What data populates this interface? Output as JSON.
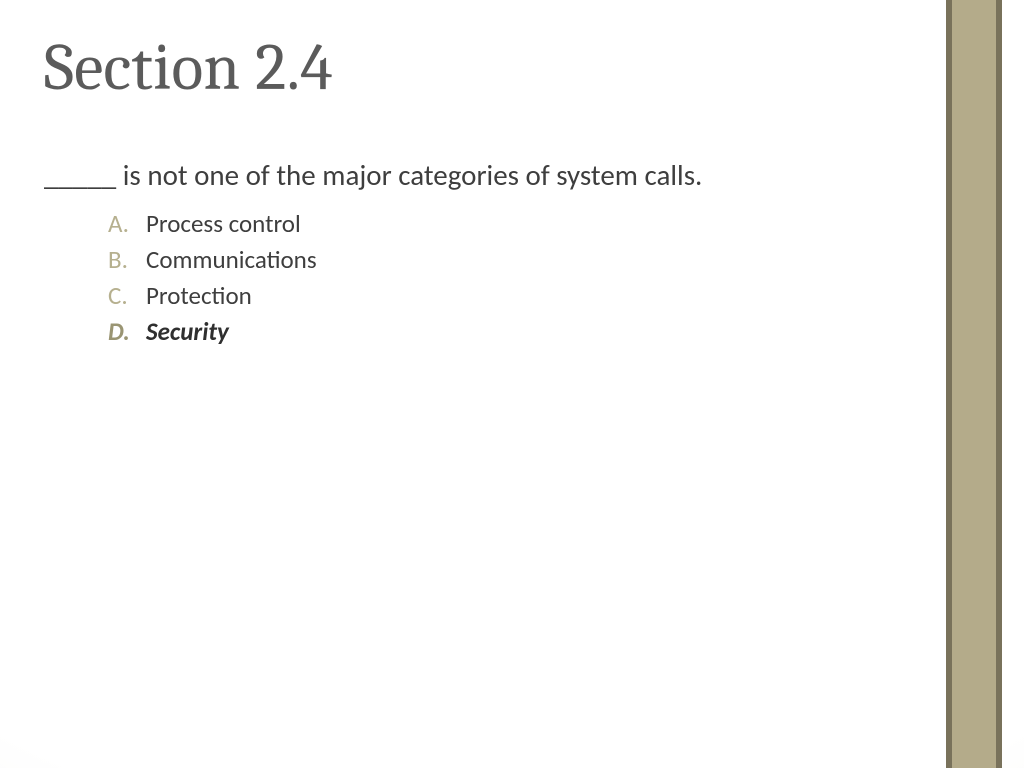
{
  "slide": {
    "title": "Section 2.4",
    "question": "_____ is not one of the major categories of system calls.",
    "options": [
      {
        "letter": "A.",
        "text": "Process control",
        "correct": false
      },
      {
        "letter": "B.",
        "text": "Communications",
        "correct": false
      },
      {
        "letter": "C.",
        "text": "Protection",
        "correct": false
      },
      {
        "letter": "D.",
        "text": "Security",
        "correct": true
      }
    ],
    "accent_colors": {
      "outer": "#79725b",
      "inner": "#b4ab8a"
    }
  }
}
